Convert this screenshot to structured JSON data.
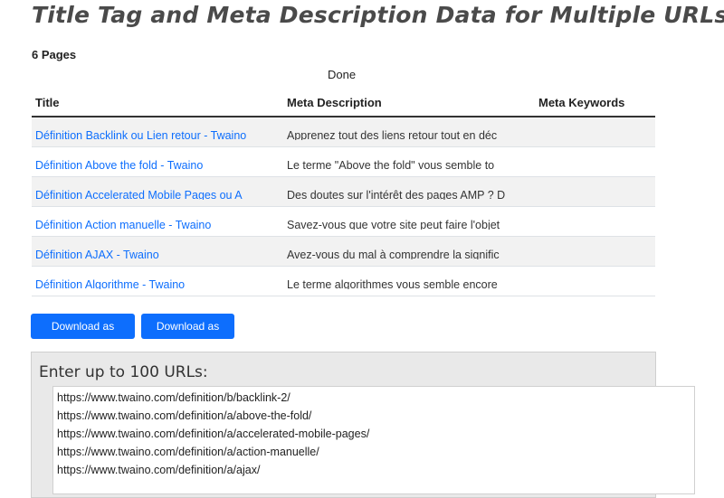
{
  "header": {
    "title": "Title Tag and Meta Description Data for Multiple URLs",
    "page_count": "6 Pages",
    "status": "Done"
  },
  "table": {
    "columns": [
      "Title",
      "Meta Description",
      "Meta Keywords"
    ],
    "rows": [
      {
        "title": "Définition Backlink ou Lien retour - Twaino",
        "meta": "Apprenez tout des liens retour tout en déc",
        "keywords": ""
      },
      {
        "title": "Définition Above the fold - Twaino",
        "meta": "Le terme \"Above the fold\" vous semble to",
        "keywords": ""
      },
      {
        "title": "Définition Accelerated Mobile Pages ou A",
        "meta": "Des doutes sur l'intérêt des pages AMP ? D",
        "keywords": ""
      },
      {
        "title": "Définition Action manuelle - Twaino",
        "meta": "Savez-vous que votre site peut faire l'objet",
        "keywords": ""
      },
      {
        "title": "Définition AJAX - Twaino",
        "meta": "Avez-vous du mal à comprendre la signific",
        "keywords": ""
      },
      {
        "title": "Définition Algorithme - Twaino",
        "meta": "Le terme algorithmes vous semble encore",
        "keywords": ""
      }
    ]
  },
  "buttons": {
    "download_html": "Download as HTML",
    "download_xls": "Download as XLS"
  },
  "url_input": {
    "label": "Enter up to 100 URLs:",
    "urls": [
      "https://www.twaino.com/definition/b/backlink-2/",
      "https://www.twaino.com/definition/a/above-the-fold/",
      "https://www.twaino.com/definition/a/accelerated-mobile-pages/",
      "https://www.twaino.com/definition/a/action-manuelle/",
      "https://www.twaino.com/definition/a/ajax/"
    ]
  }
}
